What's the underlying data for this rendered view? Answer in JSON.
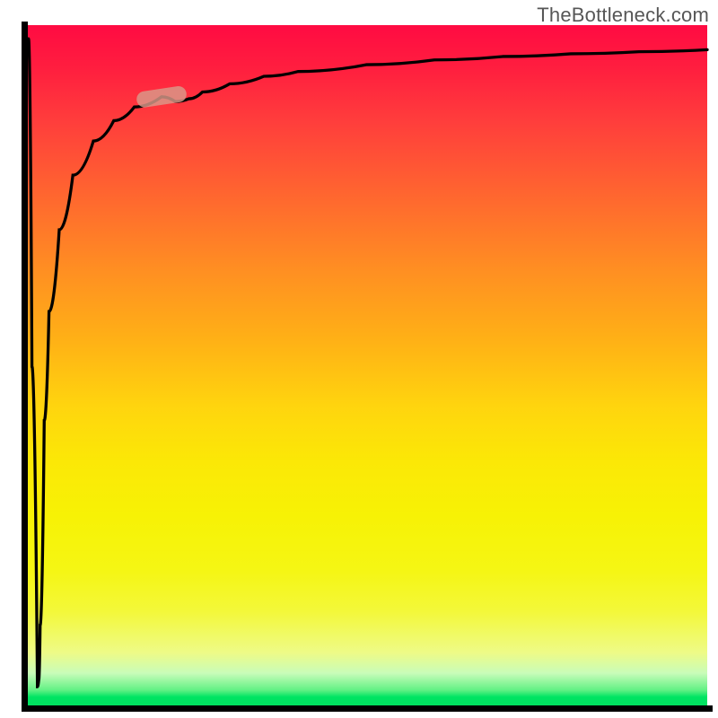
{
  "watermark": "TheBottleneck.com",
  "chart_data": {
    "type": "line",
    "title": "",
    "xlabel": "",
    "ylabel": "",
    "xlim": [
      0,
      100
    ],
    "ylim": [
      0,
      100
    ],
    "x": [
      0.5,
      1.0,
      1.8,
      2.0,
      2.2,
      2.8,
      3.5,
      5,
      7,
      10,
      13,
      16,
      20,
      22,
      24,
      26,
      30,
      35,
      40,
      50,
      60,
      70,
      80,
      90,
      100
    ],
    "values": [
      98,
      50,
      3,
      4,
      12,
      42,
      58,
      70,
      78,
      83,
      86,
      88,
      89.5,
      88.8,
      89.2,
      90.2,
      91.4,
      92.5,
      93.2,
      94.2,
      94.9,
      95.4,
      95.8,
      96.1,
      96.4
    ],
    "marker": {
      "x": 20,
      "y": 89.5
    },
    "background_gradient": [
      "#ff0b42",
      "#ff8f22",
      "#fbe806",
      "#00df5e"
    ],
    "note": "y-values measured downward from top of plot (so higher value = closer to top). The visible curve starts near x≈0.5 at the top, plunges to the bottom near x≈1.8, then rises sharply and asymptotes near the top."
  }
}
